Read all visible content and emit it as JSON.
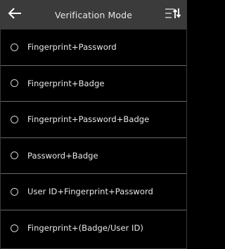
{
  "header": {
    "title": "Verification Mode",
    "back_icon": "arrow-left-icon",
    "sort_icon": "sort-icon"
  },
  "options": [
    {
      "label": "Fingerprint+Password",
      "selected": false
    },
    {
      "label": "Fingerprint+Badge",
      "selected": false
    },
    {
      "label": "Fingerprint+Password+Badge",
      "selected": false
    },
    {
      "label": "Password+Badge",
      "selected": false
    },
    {
      "label": "User ID+Fingerprint+Password",
      "selected": false
    },
    {
      "label": "Fingerprint+(Badge/User ID)",
      "selected": false
    }
  ],
  "colors": {
    "header_bg": "#3b3b3b",
    "screen_bg": "#000000",
    "text": "#e8e8e8",
    "divider": "#6a6a6a"
  }
}
